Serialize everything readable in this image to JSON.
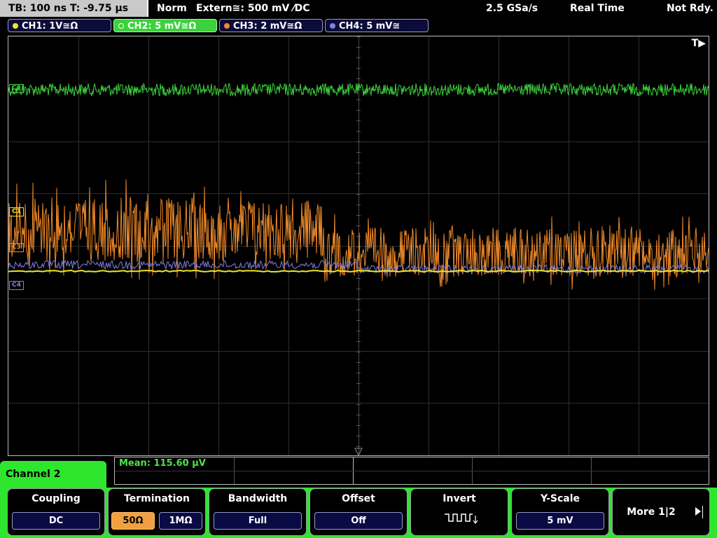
{
  "status": {
    "timebase": "TB: 100 ns   T: -9.75 µs",
    "mode": "Norm",
    "trigger": "Extern≅: 500 mV ⁄DC",
    "sample_rate": "2.5 GSa/s",
    "acq_mode": "Real Time",
    "state": "Not Rdy."
  },
  "channels": [
    {
      "label": "CH1: 1V≅Ω",
      "color": "#f2e52a"
    },
    {
      "label": "CH2: 5 mV≅Ω",
      "color": "#3bd23b"
    },
    {
      "label": "CH3: 2 mV≅Ω",
      "color": "#f08a2a"
    },
    {
      "label": "CH4: 5 mV≅",
      "color": "#8080e0"
    }
  ],
  "trigger_marker": "T▶",
  "markers": {
    "c1": "C1",
    "c2": "C2",
    "c3": "C3",
    "c4": "C4"
  },
  "measurement": {
    "mean": "Mean: 115.60 µV"
  },
  "menu": {
    "title": "Channel 2",
    "coupling": {
      "title": "Coupling",
      "value": "DC"
    },
    "termination": {
      "title": "Termination",
      "opt1": "50Ω",
      "opt2": "1MΩ"
    },
    "bandwidth": {
      "title": "Bandwidth",
      "value": "Full"
    },
    "offset": {
      "title": "Offset",
      "value": "Off"
    },
    "invert": {
      "title": "Invert"
    },
    "yscale": {
      "title": "Y-Scale",
      "value": "5 mV"
    },
    "more": {
      "label": "More 1|2"
    }
  }
}
